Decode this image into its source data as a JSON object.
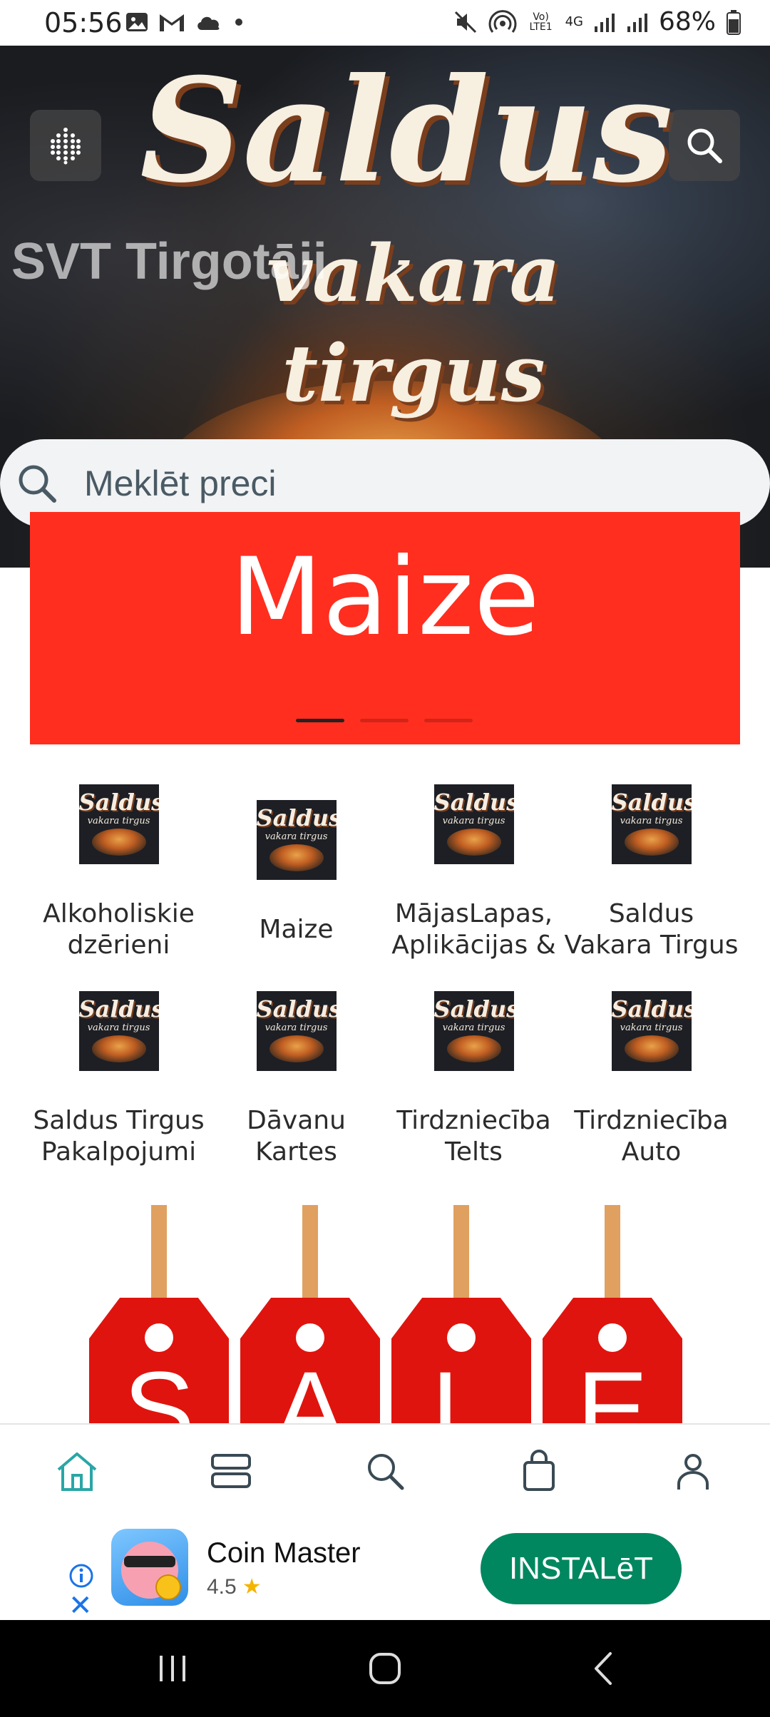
{
  "status_bar": {
    "time": "05:56",
    "network_text": "4G",
    "volte_text": "Vo) LTE1",
    "battery": "68%",
    "icons": [
      "image-icon",
      "gmail-icon",
      "cloud-icon",
      "dot-icon",
      "mute-icon",
      "hotspot-icon",
      "signal-icon",
      "signal-icon",
      "battery-icon"
    ]
  },
  "hero": {
    "brand_title": "Saldus",
    "brand_subtitle": "vakara tirgus",
    "store_name": "SVT Tirgotāji",
    "menu_icon": "grid-dots-icon",
    "search_icon": "search-icon"
  },
  "search": {
    "placeholder": "Meklēt preci"
  },
  "banner": {
    "title": "Maize",
    "slide_count": 3,
    "active_slide": 0
  },
  "categories": {
    "row1": [
      {
        "label": "Alkoholiskie\ndzērieni"
      },
      {
        "label": "Maize"
      },
      {
        "label": "MājasLapas,\nAplikācijas &"
      },
      {
        "label": "Saldus\nVakara Tirgus"
      }
    ],
    "row2": [
      {
        "label": "Saldus Tirgus\nPakalpojumi"
      },
      {
        "label": "Dāvanu\nKartes"
      },
      {
        "label": "Tirdzniecība\nTelts"
      },
      {
        "label": "Tirdzniecība\nAuto"
      }
    ],
    "thumb_title": "Saldus",
    "thumb_sub": "vakara tirgus"
  },
  "sale_banner": {
    "letters": [
      "S",
      "A",
      "L",
      "E"
    ]
  },
  "bottom_nav": {
    "items": [
      "home-icon",
      "categories-icon",
      "search-icon",
      "bag-icon",
      "profile-icon"
    ],
    "active_color": "#2aa6a6"
  },
  "ad": {
    "app_name": "Coin Master",
    "rating": "4.5",
    "install_label": "INSTALēT"
  }
}
